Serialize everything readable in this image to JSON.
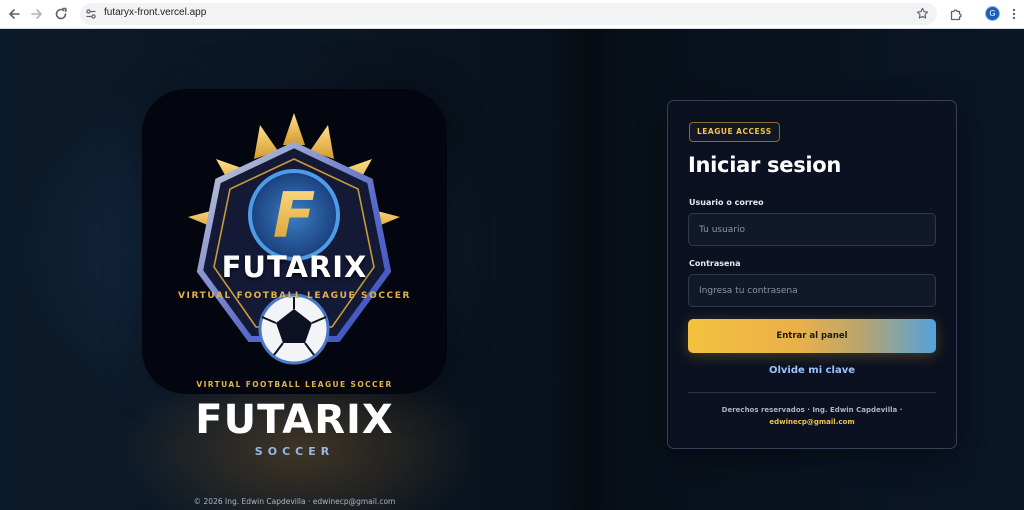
{
  "browser": {
    "url": "futaryx-front.vercel.app",
    "profile_initial": "G",
    "icons": {
      "back": "arrow-left-icon",
      "forward": "arrow-right-icon",
      "reload": "reload-icon",
      "site_settings": "tune-icon",
      "bookmark": "star-icon",
      "extensions": "puzzle-icon",
      "menu": "kebab-menu-icon"
    }
  },
  "brand": {
    "logo_letter": "F",
    "logo_title": "FUTARIX",
    "logo_subtitle": "VIRTUAL FOOTBALL LEAGUE SOCCER",
    "logo_bottom_subtitle": "VIRTUAL FOOTBALL LEAGUE SOCCER",
    "title": "FUTARIX",
    "subtitle": "SOCCER",
    "footer": "© 2026 Ing. Edwin Capdevilla · edwinecp@gmail.com"
  },
  "login": {
    "badge": "LEAGUE ACCESS",
    "title": "Iniciar sesion",
    "username_label": "Usuario o correo",
    "username_placeholder": "Tu usuario",
    "username_value": "",
    "password_label": "Contrasena",
    "password_placeholder": "Ingresa tu contrasena",
    "password_value": "",
    "submit_label": "Entrar al panel",
    "forgot_label": "Olvide mi clave",
    "rights_text": "Derechos reservados · Ing. Edwin Capdevilla ·",
    "email": "edwinecp@gmail.com"
  },
  "colors": {
    "accent_gold": "#f0c24e",
    "accent_blue": "#54a2dc",
    "card_bg": "#0b1120",
    "link_blue": "#9cc3ff"
  }
}
